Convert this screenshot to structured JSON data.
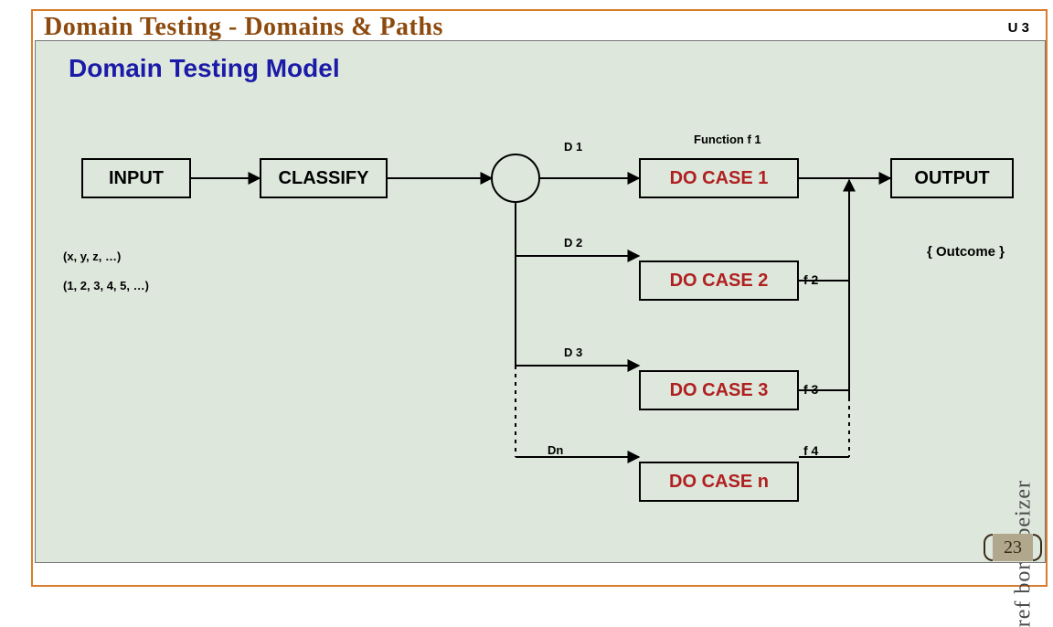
{
  "header": {
    "title": "Domain Testing  -  Domains & Paths",
    "unit": "U 3"
  },
  "panel": {
    "title": "Domain Testing Model"
  },
  "boxes": {
    "input": "INPUT",
    "classify": "CLASSIFY",
    "case1": "DO CASE 1",
    "case2": "DO CASE 2",
    "case3": "DO CASE 3",
    "casen": "DO CASE n",
    "output": "OUTPUT"
  },
  "labels": {
    "d1": "D 1",
    "d2": "D 2",
    "d3": "D 3",
    "dn": "Dn",
    "func1": "Function f 1",
    "f2": "f 2",
    "f3": "f 3",
    "f4": "f 4",
    "outcome": "{ Outcome }"
  },
  "inputs_examples": {
    "line1": "(x, y, z, …)",
    "line2": "(1, 2, 3, 4, 5, …)"
  },
  "sidebar": {
    "ref": "ref boris beizer"
  },
  "footer": {
    "page": "23"
  },
  "chart_data": {
    "type": "diagram",
    "title": "Domain Testing Model",
    "nodes": [
      {
        "id": "input",
        "label": "INPUT",
        "kind": "box"
      },
      {
        "id": "classify",
        "label": "CLASSIFY",
        "kind": "box"
      },
      {
        "id": "junction",
        "label": "",
        "kind": "circle"
      },
      {
        "id": "case1",
        "label": "DO CASE 1",
        "kind": "box"
      },
      {
        "id": "case2",
        "label": "DO CASE 2",
        "kind": "box"
      },
      {
        "id": "case3",
        "label": "DO CASE 3",
        "kind": "box"
      },
      {
        "id": "casen",
        "label": "DO CASE n",
        "kind": "box"
      },
      {
        "id": "output",
        "label": "OUTPUT",
        "kind": "box"
      }
    ],
    "edges": [
      {
        "from": "input",
        "to": "classify"
      },
      {
        "from": "classify",
        "to": "junction"
      },
      {
        "from": "junction",
        "to": "case1",
        "label": "D 1"
      },
      {
        "from": "junction",
        "to": "case2",
        "label": "D 2"
      },
      {
        "from": "junction",
        "to": "case3",
        "label": "D 3"
      },
      {
        "from": "junction",
        "to": "casen",
        "label": "Dn"
      },
      {
        "from": "case1",
        "to": "output",
        "label": "Function f 1"
      },
      {
        "from": "case2",
        "to": "output",
        "label": "f 2"
      },
      {
        "from": "case3",
        "to": "output",
        "label": "f 3"
      },
      {
        "from": "casen",
        "to": "output",
        "label": "f 4"
      }
    ],
    "annotations": {
      "input_examples": [
        "(x, y, z, …)",
        "(1, 2, 3, 4, 5, …)"
      ],
      "output_annotation": "{ Outcome }"
    }
  }
}
